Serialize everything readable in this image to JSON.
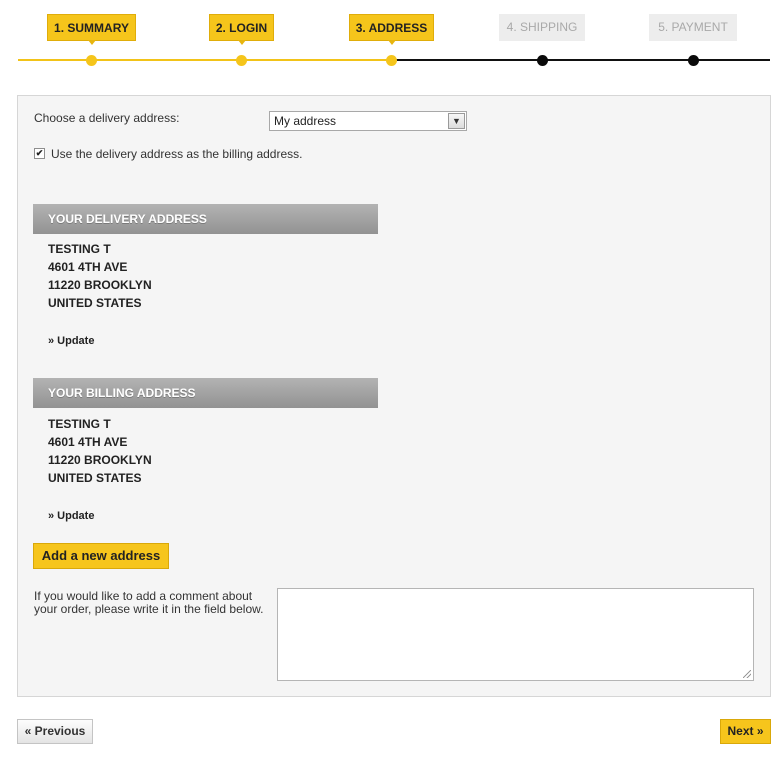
{
  "steps": [
    {
      "label": "1. SUMMARY",
      "state": "done"
    },
    {
      "label": "2. LOGIN",
      "state": "done"
    },
    {
      "label": "3. ADDRESS",
      "state": "current"
    },
    {
      "label": "4. SHIPPING",
      "state": "pending"
    },
    {
      "label": "5. PAYMENT",
      "state": "pending"
    }
  ],
  "colors": {
    "accent": "#f5c51b",
    "pending": "#0a0a0a",
    "header_bg": "#a3a3a3"
  },
  "address_form": {
    "choose_label": "Choose a delivery address:",
    "selected_address": "My address",
    "same_billing_checked": true,
    "same_billing_label": "Use the delivery address as the billing address."
  },
  "delivery": {
    "title": "YOUR DELIVERY ADDRESS",
    "name": "TESTING T",
    "street": "4601 4TH AVE",
    "city": "11220 BROOKLYN",
    "country": "UNITED STATES",
    "update_label": "» Update"
  },
  "billing": {
    "title": "YOUR BILLING ADDRESS",
    "name": "TESTING T",
    "street": "4601 4TH AVE",
    "city": "11220 BROOKLYN",
    "country": "UNITED STATES",
    "update_label": "» Update"
  },
  "add_address_label": "Add a new address",
  "comment": {
    "label": "If you would like to add a comment about your order, please write it in the field below.",
    "value": ""
  },
  "nav": {
    "previous_label": "« Previous",
    "next_label": "Next »"
  }
}
